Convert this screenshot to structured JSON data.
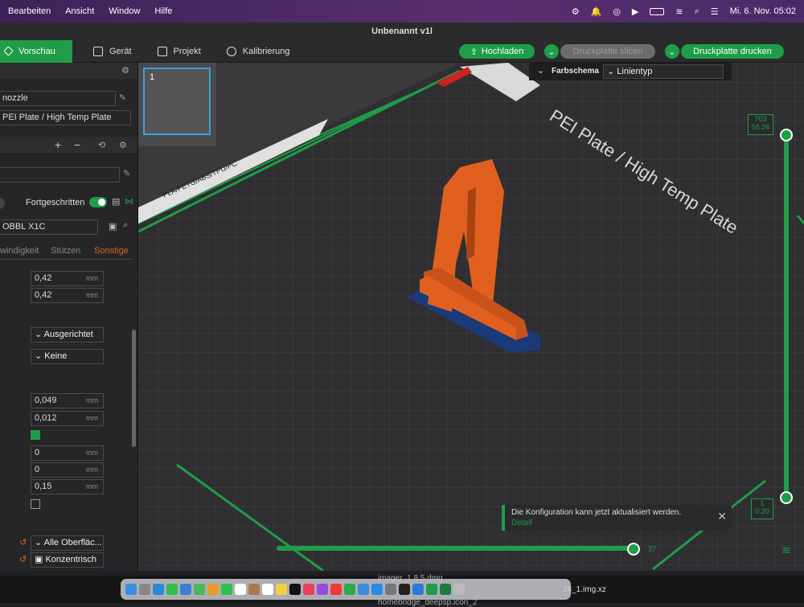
{
  "menubar": {
    "items": [
      "Bearbeiten",
      "Ansicht",
      "Window",
      "Hilfe"
    ],
    "datetime": "Mi. 6. Nov.  05:02"
  },
  "window": {
    "title": "Unbenannt v1l"
  },
  "tabs": [
    {
      "label": "Vorschau",
      "icon": "cube-icon"
    },
    {
      "label": "Gerät",
      "icon": "device-icon"
    },
    {
      "label": "Projekt",
      "icon": "project-icon"
    },
    {
      "label": "Kalibrierung",
      "icon": "calibration-icon"
    }
  ],
  "actions": {
    "upload": "Hochladen",
    "slice": "Druckplatte slicen",
    "print": "Druckplatte drucken"
  },
  "sidebar": {
    "nozzle": "nozzle",
    "plate": "PEI Plate / High Temp Plate",
    "advanced_label": "Fortgeschritten",
    "preset": "OBBL X1C",
    "subtabs": [
      "windigkeit",
      "Stützen",
      "Sonstige"
    ],
    "values": [
      "0,42",
      "0,42",
      "0,049",
      "0,012",
      "0",
      "0",
      "0,15"
    ],
    "unit": "mm",
    "dropdowns": [
      "Ausgerichtet",
      "Keine",
      "Alle Oberfläc...",
      "Konzentrisch"
    ]
  },
  "viewport": {
    "thumbnail_index": "1",
    "color_scheme_label": "Farbschema",
    "color_scheme_value": "Linientyp",
    "slider_top": [
      "703",
      "56.26"
    ],
    "slider_bottom": [
      "1",
      "0.20"
    ],
    "slider_h_value": "37",
    "bed_text": "PEI Plate / High Temp Plate",
    "bed_text_side": "PLA/PETG/ABS/TPU/PC"
  },
  "toast": {
    "message": "Die Konfiguration kann jetzt aktualisiert werden.",
    "link": "Detail"
  },
  "dock": {
    "file1": "imager_1.8.5.dmg",
    "file2": "28_1.img.xz",
    "file3": "homebridge_deepsp.icon_2"
  },
  "colors": {
    "accent": "#1f9d48",
    "part": "#e2601f",
    "brim": "#1a3a7a"
  }
}
